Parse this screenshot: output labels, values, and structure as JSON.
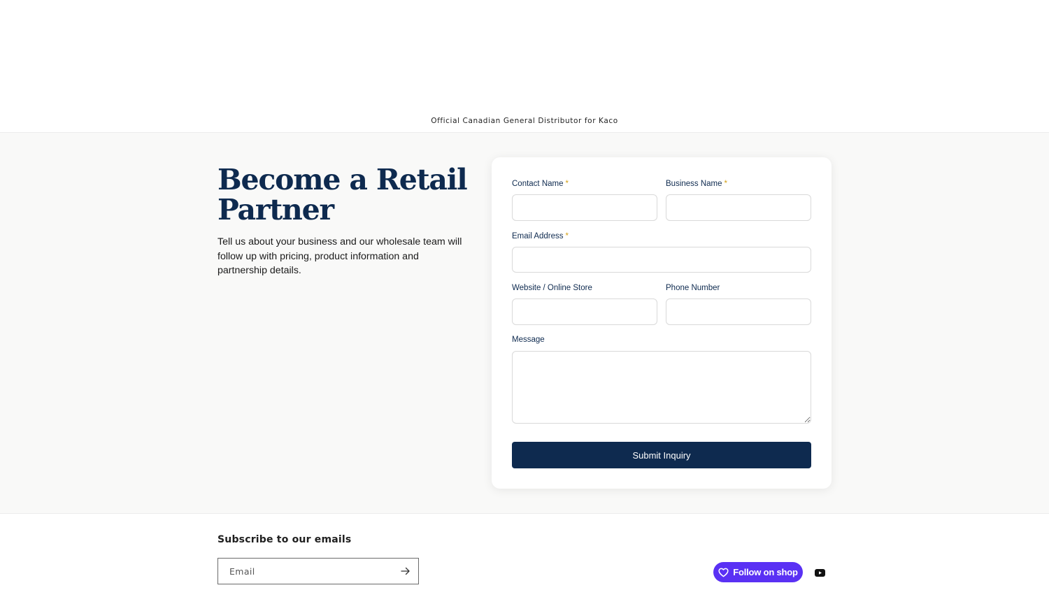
{
  "header": {
    "tagline": "Official Canadian General Distributor for Kaco"
  },
  "intro": {
    "heading": "Become a Retail Partner",
    "description": "Tell us about your business and our wholesale team will follow up with pricing, product information and partnership details."
  },
  "form": {
    "contact_name_label": "Contact Name",
    "business_name_label": "Business Name",
    "email_label": "Email Address",
    "website_label": "Website / Online Store",
    "phone_label": "Phone Number",
    "message_label": "Message",
    "required_mark": "*",
    "submit_label": "Submit Inquiry"
  },
  "footer": {
    "subscribe_title": "Subscribe to our emails",
    "email_placeholder": "Email",
    "shop_button_label": "Follow on shop"
  },
  "colors": {
    "brand_navy": "#0e2a4f",
    "required_gold": "#d4a017",
    "shop_purple": "#5a31f4"
  },
  "icons": {
    "subscribe_arrow": "arrow-right-icon",
    "shop_heart": "heart-icon",
    "youtube": "youtube-icon"
  }
}
